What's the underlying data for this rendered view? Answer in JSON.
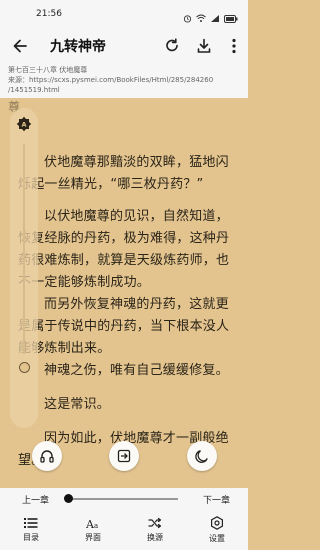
{
  "status": {
    "time": "21:56"
  },
  "appbar": {
    "title": "九转神帝"
  },
  "source": {
    "chapter_line": "第七百三十八章 伏地魔尊",
    "url_line1": "来源：https://scxs.pysmei.com/BookFiles/Html/285/284260",
    "url_line2": "/1451519.html"
  },
  "reader": {
    "prev_fragment": "尊",
    "paragraphs": [
      "伏地魔尊那黯淡的双眸，猛地闪烁起一丝精光，“哪三枚丹药？”",
      "以伏地魔尊的见识，自然知道，恢复经脉的丹药，极为难得，这种丹药很难炼制，就算是天级炼药师，也不一定能够炼制成功。",
      "而另外恢复神魂的丹药，这就更是属于传说中的丹药，当下根本没人能够炼制出来。",
      "神魂之伤，唯有自己缓缓修复。",
      "这是常识。",
      "因为如此，伏地魔尊才一副般绝望。"
    ]
  },
  "chapter_nav": {
    "prev": "上一章",
    "next": "下一章",
    "progress": 0.02
  },
  "bottom_nav": [
    {
      "label": "目录",
      "icon": "list-icon"
    },
    {
      "label": "界面",
      "icon": "font-icon"
    },
    {
      "label": "换源",
      "icon": "shuffle-icon"
    },
    {
      "label": "设置",
      "icon": "settings-icon"
    }
  ]
}
